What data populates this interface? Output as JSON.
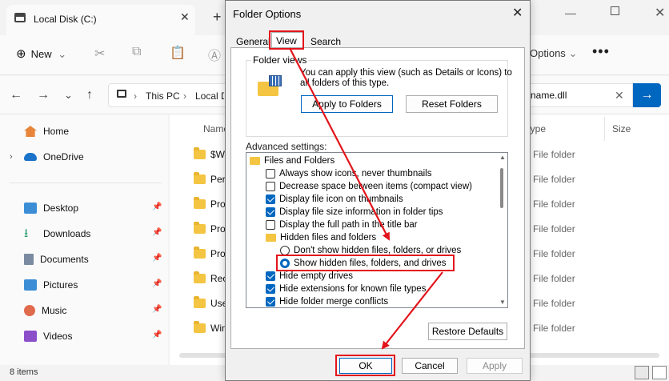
{
  "explorer": {
    "tab_title": "Local Disk (C:)",
    "tab_close": "✕",
    "new_tab": "+",
    "window": {
      "minimize": "—",
      "close": "✕"
    },
    "toolbar": {
      "new_label": "New",
      "new_icon": "⊕",
      "chevron": "⌄",
      "options_label": "Options",
      "more": "•••"
    },
    "address": {
      "crumb1": "This PC",
      "sep": "›",
      "crumb2": "Local Disk (C:)",
      "search_text": "name.dll",
      "search_clear": "✕",
      "search_go": "→"
    },
    "nav": {
      "back": "←",
      "forward": "→",
      "down": "⌄",
      "up": "↑"
    },
    "sidebar": {
      "top_items": [
        {
          "label": "Home",
          "icon": "home-icon"
        },
        {
          "label": "OneDrive",
          "icon": "cloud-icon"
        }
      ],
      "expand": "›",
      "pinned": [
        {
          "label": "Desktop",
          "icon": "desktop-icon",
          "color": "#3b8ed6"
        },
        {
          "label": "Downloads",
          "icon": "download-icon",
          "color": "#2f9e6f"
        },
        {
          "label": "Documents",
          "icon": "document-icon",
          "color": "#7a8aa0"
        },
        {
          "label": "Pictures",
          "icon": "pictures-icon",
          "color": "#3b8ed6"
        },
        {
          "label": "Music",
          "icon": "music-icon",
          "color": "#e06a4c"
        },
        {
          "label": "Videos",
          "icon": "videos-icon",
          "color": "#8a4fc9"
        }
      ],
      "pin_glyph": "📌"
    },
    "columns": {
      "name": "Name",
      "type": "Type",
      "size": "Size"
    },
    "files": [
      {
        "name": "$Wi",
        "type": "File folder"
      },
      {
        "name": "Perf",
        "type": "File folder"
      },
      {
        "name": "Prog",
        "type": "File folder"
      },
      {
        "name": "Prog",
        "type": "File folder"
      },
      {
        "name": "Prog",
        "type": "File folder"
      },
      {
        "name": "Rec",
        "type": "File folder"
      },
      {
        "name": "Use",
        "type": "File folder"
      },
      {
        "name": "Win",
        "type": "File folder"
      }
    ],
    "status": "8 items"
  },
  "dialog": {
    "title": "Folder Options",
    "close": "✕",
    "tabs": [
      "General",
      "View",
      "Search"
    ],
    "active_tab": "View",
    "folder_views": {
      "label": "Folder views",
      "description_line1": "You can apply this view (such as Details or Icons) to",
      "description_line2": "all folders of this type.",
      "apply_button": "Apply to Folders",
      "reset_button": "Reset Folders"
    },
    "advanced_label": "Advanced settings:",
    "settings": [
      {
        "kind": "folder",
        "label": "Files and Folders"
      },
      {
        "kind": "checkbox",
        "checked": false,
        "label": "Always show icons, never thumbnails"
      },
      {
        "kind": "checkbox",
        "checked": false,
        "label": "Decrease space between items (compact view)"
      },
      {
        "kind": "checkbox",
        "checked": true,
        "label": "Display file icon on thumbnails"
      },
      {
        "kind": "checkbox",
        "checked": true,
        "label": "Display file size information in folder tips"
      },
      {
        "kind": "checkbox",
        "checked": false,
        "label": "Display the full path in the title bar"
      },
      {
        "kind": "folder",
        "label": "Hidden files and folders"
      },
      {
        "kind": "radio",
        "checked": false,
        "label": "Don't show hidden files, folders, or drives"
      },
      {
        "kind": "radio",
        "checked": true,
        "label": "Show hidden files, folders, and drives"
      },
      {
        "kind": "checkbox",
        "checked": true,
        "label": "Hide empty drives"
      },
      {
        "kind": "checkbox",
        "checked": true,
        "label": "Hide extensions for known file types"
      },
      {
        "kind": "checkbox",
        "checked": true,
        "label": "Hide folder merge conflicts"
      }
    ],
    "restore_button": "Restore Defaults",
    "ok_button": "OK",
    "cancel_button": "Cancel",
    "apply_button": "Apply",
    "scroll_up": "▲",
    "scroll_down": "▼"
  },
  "annotation_color": "#e3141b"
}
